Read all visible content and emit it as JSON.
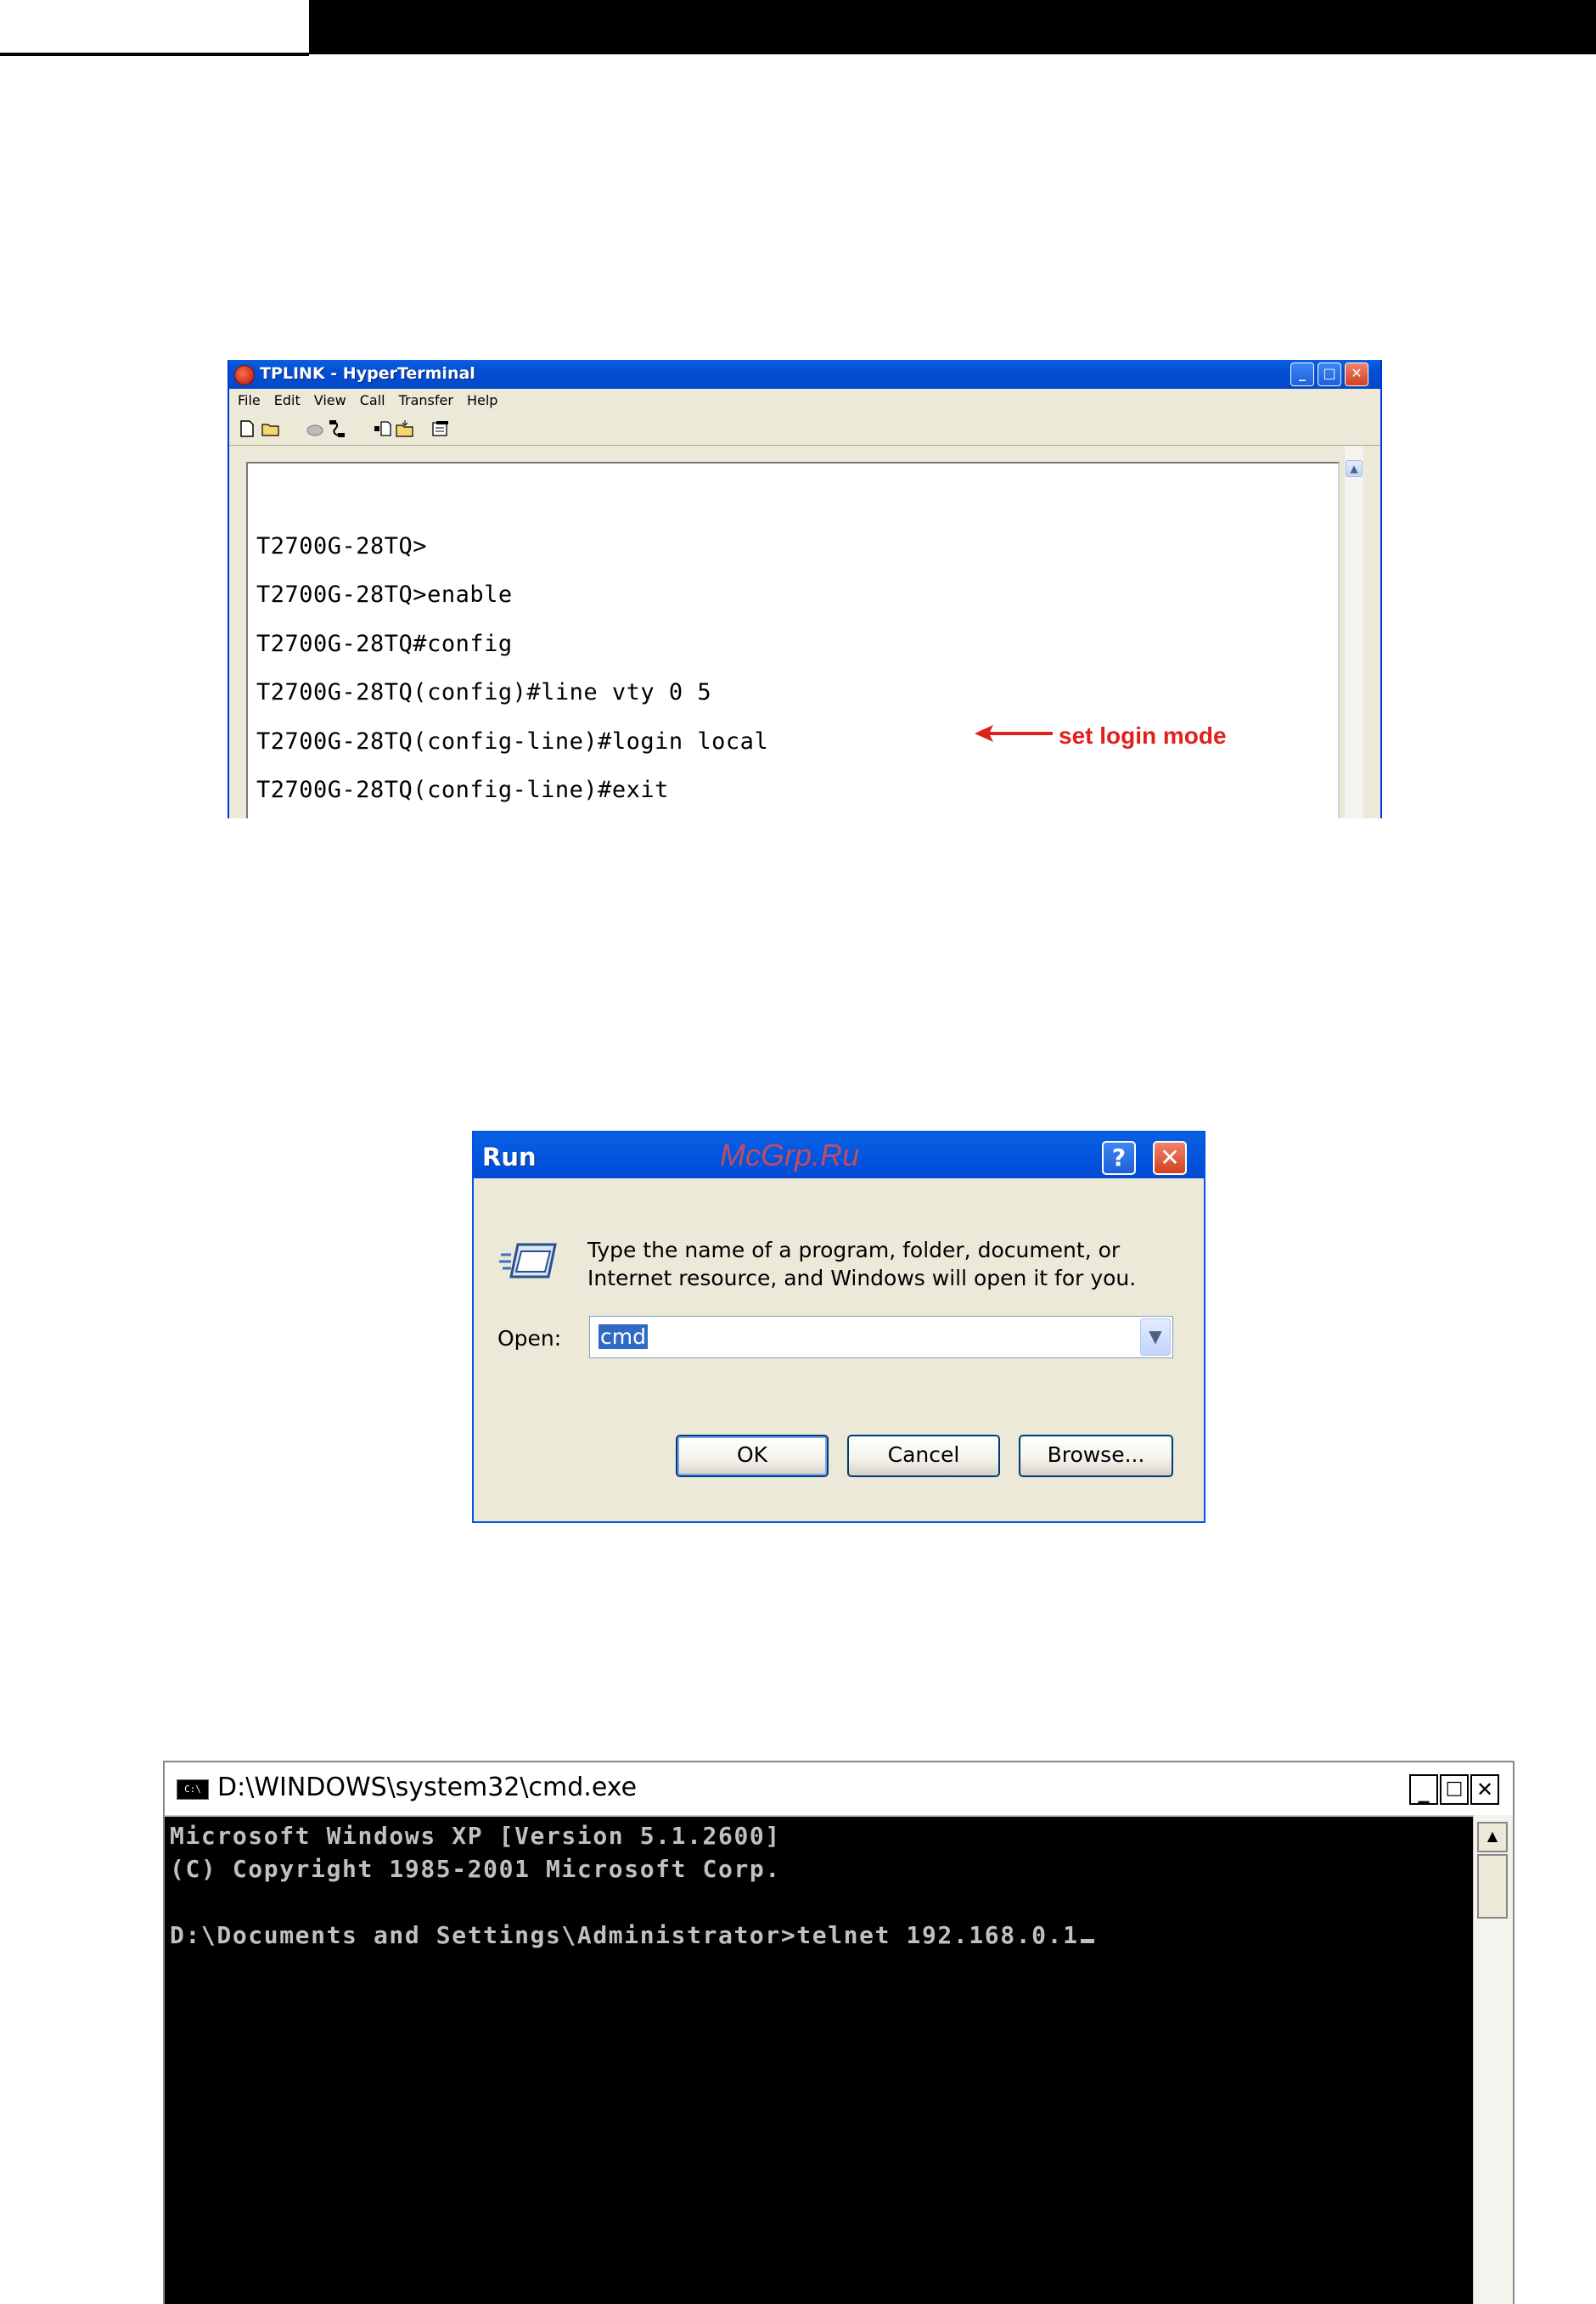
{
  "hyperterminal": {
    "title": "TPLINK - HyperTerminal",
    "menu": [
      "File",
      "Edit",
      "View",
      "Call",
      "Transfer",
      "Help"
    ],
    "lines": [
      "T2700G-28TQ>",
      "T2700G-28TQ>enable",
      "T2700G-28TQ#config",
      "T2700G-28TQ(config)#line vty 0 5",
      "T2700G-28TQ(config-line)#login local",
      "T2700G-28TQ(config-line)#exit"
    ],
    "annotation": "set login mode",
    "annotation_color": "#e0201b"
  },
  "run_dialog": {
    "title": "Run",
    "watermark": "McGrp.Ru",
    "description_line1": "Type the name of a program, folder, document, or",
    "description_line2": "Internet resource, and Windows will open it for you.",
    "open_label": "Open:",
    "open_value": "cmd",
    "buttons": {
      "ok": "OK",
      "cancel": "Cancel",
      "browse": "Browse..."
    }
  },
  "cmd_window": {
    "title": "D:\\WINDOWS\\system32\\cmd.exe",
    "icon_text": "C:\\",
    "lines": [
      "Microsoft Windows XP [Version 5.1.2600]",
      "(C) Copyright 1985-2001 Microsoft Corp.",
      "",
      "D:\\Documents and Settings\\Administrator>telnet 192.168.0.1"
    ]
  }
}
